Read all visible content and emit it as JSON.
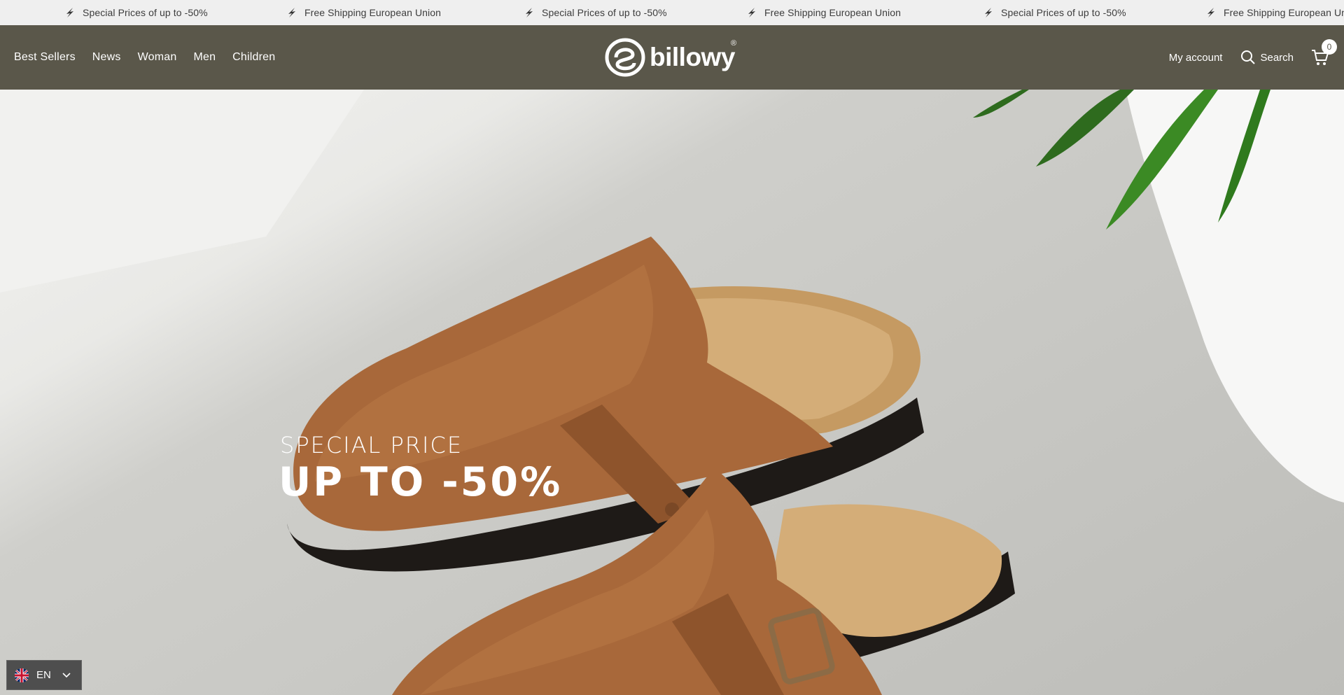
{
  "announcement": {
    "items": [
      "Special Prices of up to -50%",
      "Free Shipping European Union",
      "Special Prices of up to -50%",
      "Free Shipping European Union",
      "Special Prices of up to -50%",
      "Free Shipping European Uni"
    ],
    "icon": "lightning-icon"
  },
  "header": {
    "nav": [
      "Best Sellers",
      "News",
      "Woman",
      "Men",
      "Children"
    ],
    "logo_text": "billowy",
    "logo_mark": "®",
    "account_label": "My account",
    "search_label": "Search",
    "cart_count": "0"
  },
  "hero": {
    "subtitle": "SPECIAL PRICE",
    "title": "UP TO -50%"
  },
  "language": {
    "code": "EN",
    "flag": "uk-flag-icon"
  },
  "colors": {
    "header_bg": "#5a574a",
    "announce_bg": "#efefef",
    "shoe": "#a8683a"
  }
}
